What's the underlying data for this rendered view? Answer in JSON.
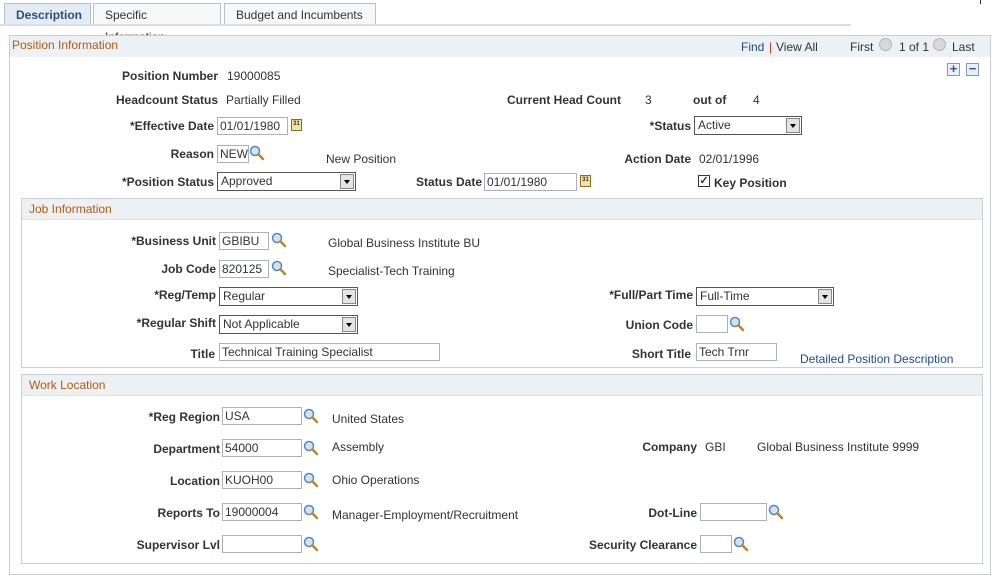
{
  "tabs": [
    {
      "label": "Description",
      "active": true
    },
    {
      "label": "Specific Information",
      "active": false
    },
    {
      "label": "Budget and Incumbents",
      "active": false
    }
  ],
  "position_info": {
    "title": "Position Information",
    "nav": {
      "find": "Find",
      "sep": "|",
      "view_all": "View All",
      "first": "First",
      "count": "1 of 1",
      "last": "Last"
    },
    "add_row": "+",
    "delete_row": "−",
    "position_number": {
      "label": "Position Number",
      "value": "19000085"
    },
    "headcount_status": {
      "label": "Headcount Status",
      "value": "Partially Filled"
    },
    "current_head_count": {
      "label": "Current Head Count",
      "value": "3",
      "out_of_label": "out of",
      "max": "4"
    },
    "effective_date": {
      "label": "*Effective Date",
      "value": "01/01/1980"
    },
    "status": {
      "label": "*Status",
      "value": "Active"
    },
    "reason": {
      "label": "Reason",
      "value": "NEW",
      "description": "New Position"
    },
    "action_date": {
      "label": "Action Date",
      "value": "02/01/1996"
    },
    "position_status": {
      "label": "*Position Status",
      "value": "Approved"
    },
    "status_date": {
      "label": "Status Date",
      "value": "01/01/1980"
    },
    "key_position": {
      "label": "Key Position",
      "checked": true
    }
  },
  "job_info": {
    "title": "Job Information",
    "business_unit": {
      "label": "*Business Unit",
      "value": "GBIBU",
      "description": "Global Business Institute BU"
    },
    "job_code": {
      "label": "Job Code",
      "value": "820125",
      "description": "Specialist-Tech Training"
    },
    "reg_temp": {
      "label": "*Reg/Temp",
      "value": "Regular"
    },
    "full_part_time": {
      "label": "*Full/Part Time",
      "value": "Full-Time"
    },
    "regular_shift": {
      "label": "*Regular Shift",
      "value": "Not Applicable"
    },
    "union_code": {
      "label": "Union Code",
      "value": ""
    },
    "title_field": {
      "label": "Title",
      "value": "Technical Training Specialist"
    },
    "short_title": {
      "label": "Short Title",
      "value": "Tech Trnr"
    },
    "detailed_link": "Detailed Position Description"
  },
  "work_location": {
    "title": "Work Location",
    "reg_region": {
      "label": "*Reg Region",
      "value": "USA",
      "description": "United States"
    },
    "department": {
      "label": "Department",
      "value": "54000",
      "description": "Assembly"
    },
    "company": {
      "label": "Company",
      "value": "GBI",
      "description": "Global Business Institute 9999"
    },
    "location": {
      "label": "Location",
      "value": "KUOH00",
      "description": "Ohio Operations"
    },
    "reports_to": {
      "label": "Reports To",
      "value": "19000004",
      "description": "Manager-Employment/Recruitment"
    },
    "dot_line": {
      "label": "Dot-Line",
      "value": ""
    },
    "supervisor_lvl": {
      "label": "Supervisor Lvl",
      "value": ""
    },
    "security_clearance": {
      "label": "Security Clearance",
      "value": ""
    }
  }
}
